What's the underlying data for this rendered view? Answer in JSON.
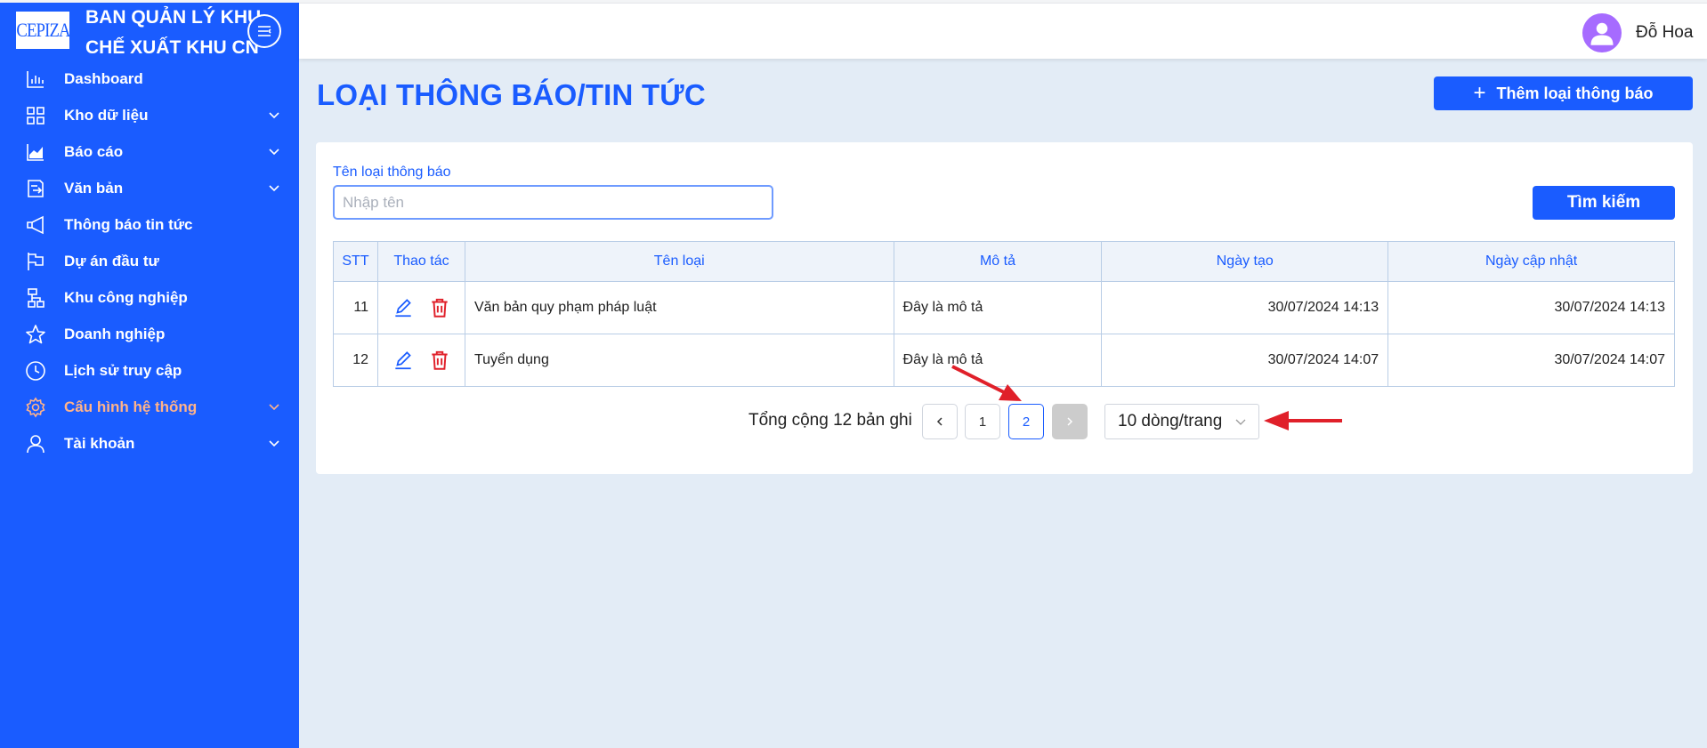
{
  "brand": {
    "logo_text": "CEPIZA",
    "title_line1": "BAN QUẢN LÝ KHU",
    "title_line2": "CHẾ XUẤT KHU CN"
  },
  "sidebar": {
    "items": [
      {
        "label": "Dashboard",
        "icon": "bar-chart-icon",
        "has_submenu": false,
        "active": false
      },
      {
        "label": "Kho dữ liệu",
        "icon": "grid-icon",
        "has_submenu": true,
        "active": false
      },
      {
        "label": "Báo cáo",
        "icon": "area-chart-icon",
        "has_submenu": true,
        "active": false
      },
      {
        "label": "Văn bản",
        "icon": "document-icon",
        "has_submenu": true,
        "active": false
      },
      {
        "label": "Thông báo tin tức",
        "icon": "megaphone-icon",
        "has_submenu": false,
        "active": false
      },
      {
        "label": "Dự án đầu tư",
        "icon": "flag-icon",
        "has_submenu": false,
        "active": false
      },
      {
        "label": "Khu công nghiệp",
        "icon": "cluster-icon",
        "has_submenu": false,
        "active": false
      },
      {
        "label": "Doanh nghiệp",
        "icon": "star-icon",
        "has_submenu": false,
        "active": false
      },
      {
        "label": "Lịch sử truy cập",
        "icon": "clock-icon",
        "has_submenu": false,
        "active": false
      },
      {
        "label": "Cấu hình hệ thống",
        "icon": "gear-icon",
        "has_submenu": true,
        "active": true
      },
      {
        "label": "Tài khoản",
        "icon": "user-icon",
        "has_submenu": true,
        "active": false
      }
    ],
    "active_color": "#ffb38a"
  },
  "header": {
    "username": "Đỗ Hoa"
  },
  "main": {
    "title": "LOẠI THÔNG BÁO/TIN TỨC",
    "add_button": "Thêm loại thông báo",
    "search": {
      "label": "Tên loại thông báo",
      "placeholder": "Nhập tên",
      "value": "",
      "button": "Tìm kiếm"
    },
    "table": {
      "headers": [
        "STT",
        "Thao tác",
        "Tên loại",
        "Mô tả",
        "Ngày tạo",
        "Ngày cập nhật"
      ],
      "rows": [
        {
          "stt": "11",
          "name": "Văn bản quy phạm pháp luật",
          "desc": "Đây là mô tả",
          "created": "30/07/2024 14:13",
          "updated": "30/07/2024 14:13"
        },
        {
          "stt": "12",
          "name": "Tuyển dụng",
          "desc": "Đây là mô tả",
          "created": "30/07/2024 14:07",
          "updated": "30/07/2024 14:07"
        }
      ]
    },
    "pagination": {
      "total_text": "Tổng cộng 12 bản ghi",
      "pages": [
        "1",
        "2"
      ],
      "current_page": "2",
      "page_size": "10 dòng/trang"
    }
  },
  "colors": {
    "primary": "#1a5cff",
    "background": "#e3ecf6",
    "delete": "#e0202a",
    "annotation_arrow": "#e0202a"
  }
}
